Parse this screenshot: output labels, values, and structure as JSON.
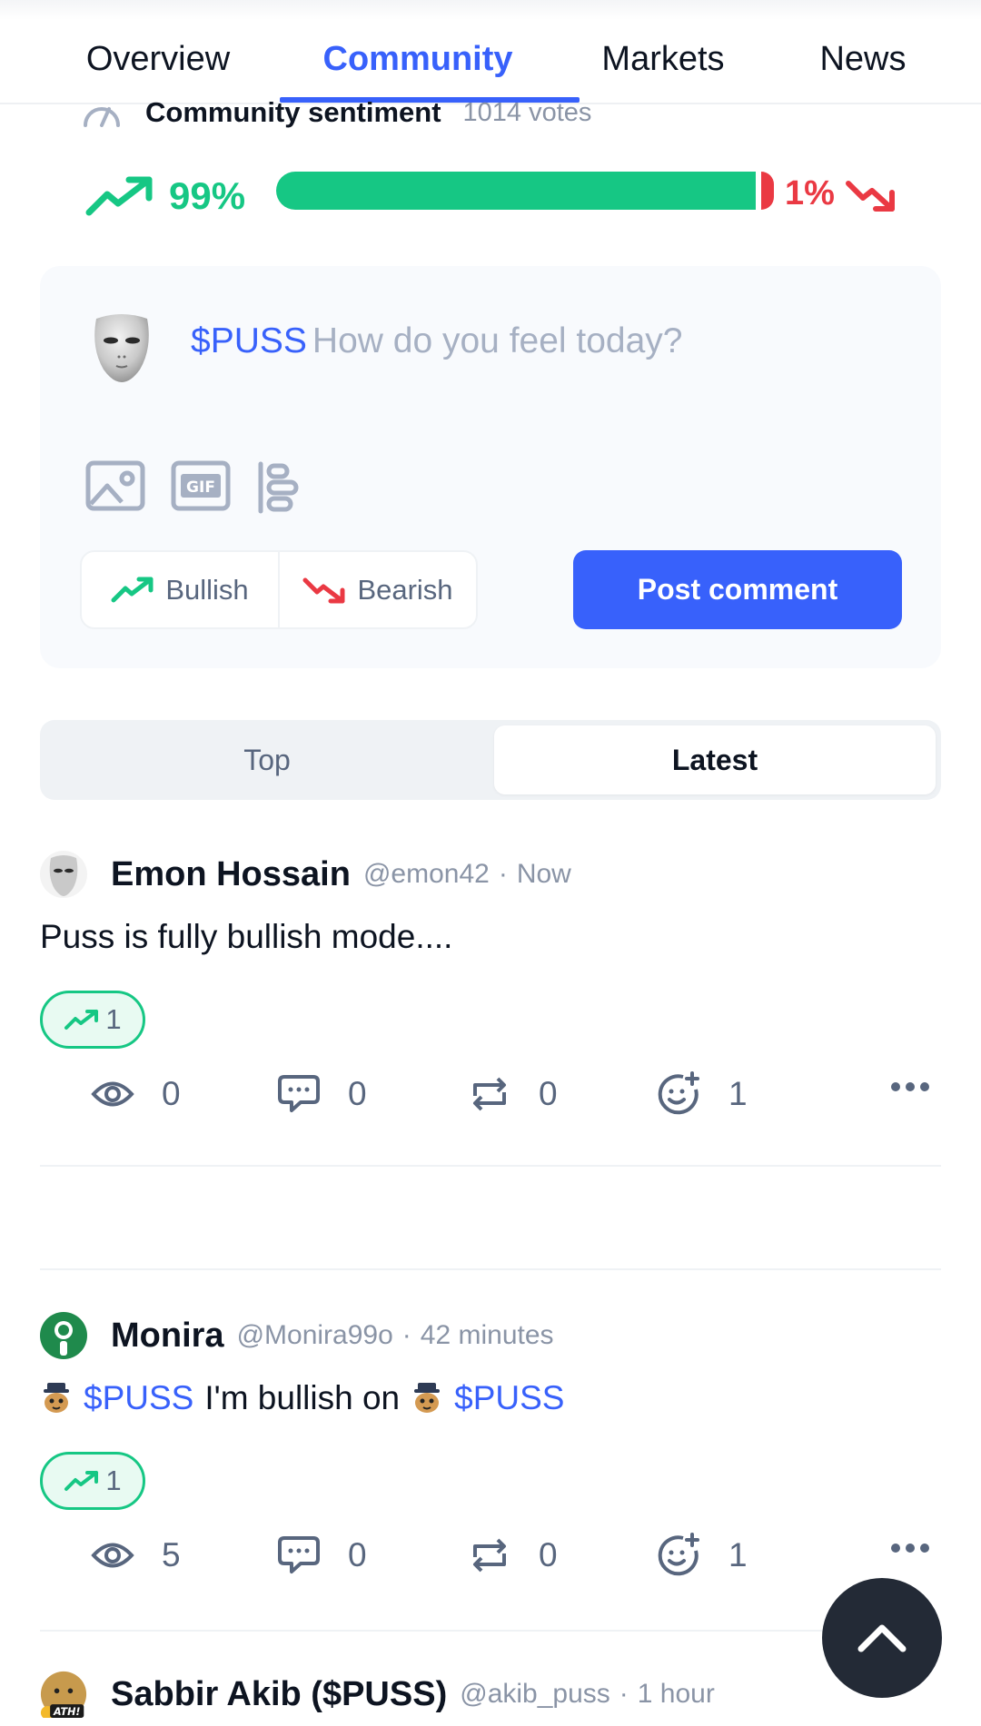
{
  "tabs": [
    {
      "label": "Overview",
      "active": false
    },
    {
      "label": "Community",
      "active": true
    },
    {
      "label": "Markets",
      "active": false
    },
    {
      "label": "News",
      "active": false
    }
  ],
  "sentiment": {
    "title": "Community sentiment",
    "votes": "1014 votes",
    "bullish_label": "99%",
    "bearish_label": "1%",
    "bullish_fraction": 0.99,
    "bearish_fraction": 0.01
  },
  "composer": {
    "ticker": "$PUSS",
    "placeholder": "How do you feel today?",
    "tools": [
      "image-icon",
      "gif-icon",
      "poll-icon"
    ],
    "bullish_label": "Bullish",
    "bearish_label": "Bearish",
    "post_label": "Post comment"
  },
  "sort": {
    "top_label": "Top",
    "latest_label": "Latest",
    "selected": "Latest"
  },
  "posts": [
    {
      "name": "Emon Hossain",
      "handle": "@emon42",
      "separator": "·",
      "time": "Now",
      "text": "Puss is fully bullish mode....",
      "bullish_count": "1",
      "views": "0",
      "comments": "0",
      "reposts": "0",
      "reactions": "1"
    },
    {
      "name": "Monira",
      "handle": "@Monira99o",
      "separator": "·",
      "time": "42 minutes",
      "text_parts": [
        "$PUSS",
        "I'm bullish on",
        "$PUSS"
      ],
      "bullish_count": "1",
      "views": "5",
      "comments": "0",
      "reposts": "0",
      "reactions": "1"
    },
    {
      "name": "Sabbir Akib ($PUSS)",
      "handle": "@akib_puss",
      "separator": "·",
      "time": "1 hour",
      "avatar_badge": "ATH!"
    }
  ],
  "colors": {
    "accent": "#3861fb",
    "bullish": "#16c784",
    "bearish": "#ea3943",
    "text": "#0d1421",
    "muted": "#8a94a6"
  }
}
